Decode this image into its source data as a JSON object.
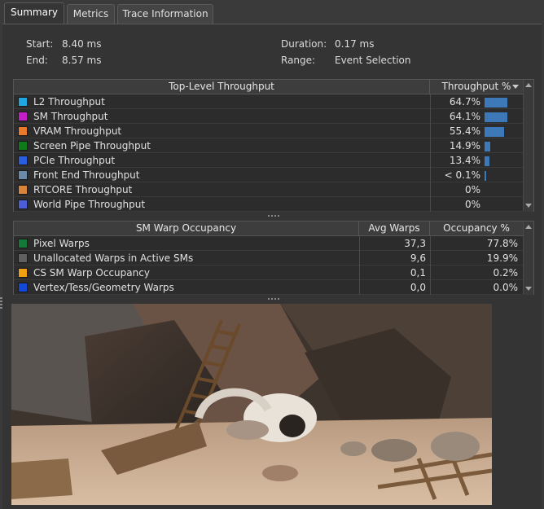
{
  "tabs": [
    {
      "label": "Summary",
      "active": true
    },
    {
      "label": "Metrics",
      "active": false
    },
    {
      "label": "Trace Information",
      "active": false
    }
  ],
  "info": {
    "start_label": "Start:",
    "start_value": "8.40 ms",
    "end_label": "End:",
    "end_value": "8.57 ms",
    "duration_label": "Duration:",
    "duration_value": "0.17 ms",
    "range_label": "Range:",
    "range_value": "Event Selection"
  },
  "throughput_table": {
    "col_name": "Top-Level Throughput",
    "col_value": "Throughput %",
    "rows": [
      {
        "name": "L2 Throughput",
        "value": "64.7%",
        "pct": 64.7,
        "color": "#1ea7e0"
      },
      {
        "name": "SM Throughput",
        "value": "64.1%",
        "pct": 64.1,
        "color": "#c81ec8"
      },
      {
        "name": "VRAM Throughput",
        "value": "55.4%",
        "pct": 55.4,
        "color": "#e87a2a"
      },
      {
        "name": "Screen Pipe Throughput",
        "value": "14.9%",
        "pct": 14.9,
        "color": "#0e7a1a"
      },
      {
        "name": "PCIe Throughput",
        "value": "13.4%",
        "pct": 13.4,
        "color": "#2a5ee0"
      },
      {
        "name": "Front End Throughput",
        "value": "< 0.1%",
        "pct": 0.1,
        "color": "#6b8aa8"
      },
      {
        "name": "RTCORE Throughput",
        "value": "0%",
        "pct": 0,
        "color": "#d8843a"
      },
      {
        "name": "World Pipe Throughput",
        "value": "0%",
        "pct": 0,
        "color": "#4a5ed8"
      }
    ]
  },
  "warp_table": {
    "col_name": "SM Warp Occupancy",
    "col_avg": "Avg Warps",
    "col_occ": "Occupancy %",
    "rows": [
      {
        "name": "Pixel Warps",
        "avg": "37,3",
        "occ": "77.8%",
        "color": "#137a3a"
      },
      {
        "name": "Unallocated Warps in Active SMs",
        "avg": "9,6",
        "occ": "19.9%",
        "color": "#606060"
      },
      {
        "name": "CS SM Warp Occupancy",
        "avg": "0,1",
        "occ": "0.2%",
        "color": "#f0a010"
      },
      {
        "name": "Vertex/Tess/Geometry Warps",
        "avg": "0,0",
        "occ": "0.0%",
        "color": "#1448d8"
      }
    ]
  }
}
